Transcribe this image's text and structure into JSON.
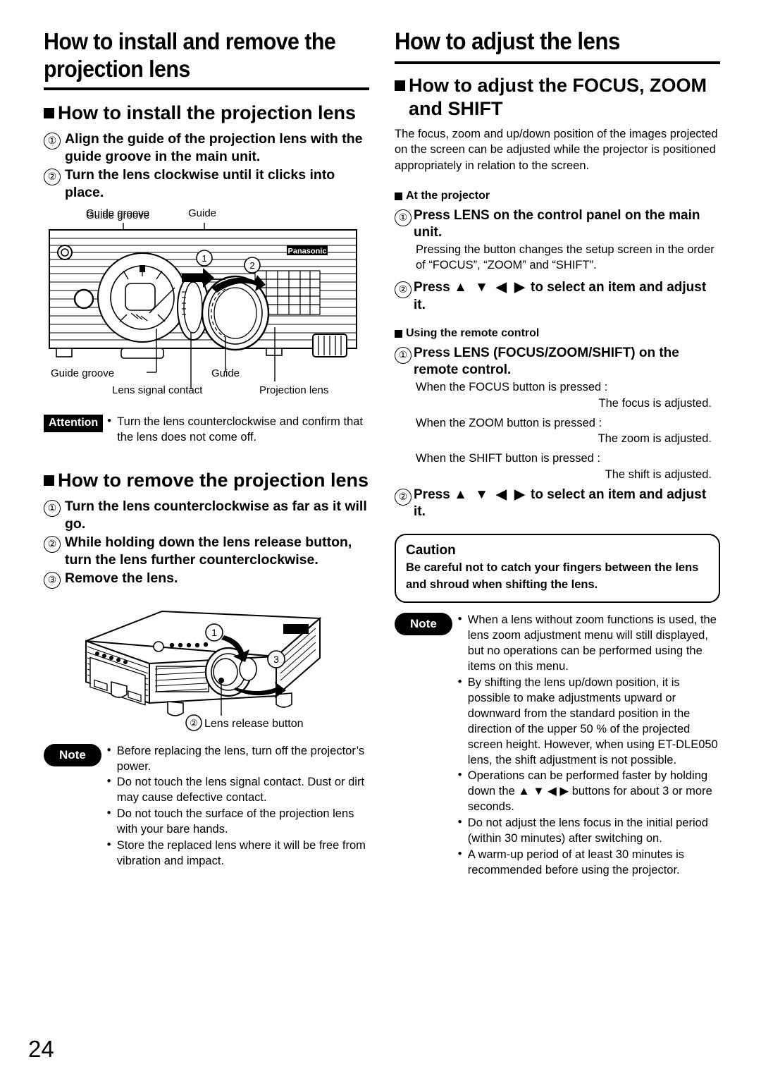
{
  "page": {
    "number": "24"
  },
  "left_column": {
    "title": "How to install and remove the projection lens",
    "install": {
      "heading": "How to install the projection lens",
      "steps": [
        {
          "num": "①",
          "text": "Align the guide of the projection lens with the guide groove in the main unit."
        },
        {
          "num": "②",
          "text": "Turn the lens clockwise until it clicks into place."
        }
      ],
      "figure": {
        "name": "lens-mount-illustration",
        "labels": {
          "guide_groove_top": "Guide groove",
          "guide_top": "Guide",
          "brand": "Panasonic",
          "marker_1": "1",
          "marker_2": "2",
          "guide_groove_bottom": "Guide groove",
          "guide_bottom": "Guide",
          "lens_signal_contact": "Lens signal contact",
          "projection_lens": "Projection lens"
        }
      },
      "attention": {
        "badge": "Attention",
        "items": [
          "Turn the lens counterclockwise and confirm that the lens does not come off."
        ]
      }
    },
    "remove": {
      "heading": "How to remove the projection lens",
      "steps": [
        {
          "num": "①",
          "text": "Turn the lens counterclockwise as far as it will go."
        },
        {
          "num": "②",
          "text": "While holding down the lens release button, turn the lens further counterclockwise."
        },
        {
          "num": "③",
          "text": "Remove the lens."
        }
      ],
      "figure": {
        "name": "projector-body-illustration",
        "labels": {
          "marker_1": "1",
          "marker_3": "3",
          "lens_release_button": "Lens release button",
          "lens_release_marker": "②"
        }
      },
      "note": {
        "badge": "Note",
        "items": [
          "Before replacing the lens, turn off the projector’s power.",
          "Do not touch the lens signal contact. Dust or dirt may cause defective contact.",
          "Do not touch the surface of the projection lens with your bare hands.",
          "Store the replaced lens where it will be free from vibration and impact."
        ]
      }
    }
  },
  "right_column": {
    "title": "How to adjust the lens",
    "adjust": {
      "heading": "How to adjust the FOCUS, ZOOM and SHIFT",
      "intro": "The focus, zoom and up/down position of the images projected on the screen can be adjusted while the projector is positioned appropriately in relation to the screen.",
      "at_projector": {
        "heading": "At the projector",
        "step1": {
          "num": "①",
          "text": "Press LENS on the control panel on the main unit."
        },
        "step1_note": "Pressing the button changes the setup screen in the order of “FOCUS”, “ZOOM” and “SHIFT”.",
        "step2": {
          "num": "②",
          "text_before": "Press",
          "arrows": "▲ ▼ ◀ ▶",
          "text_after": "to select an item and adjust it."
        }
      },
      "remote": {
        "heading": "Using the remote control",
        "step1": {
          "num": "①",
          "text": "Press LENS (FOCUS/ZOOM/SHIFT) on the remote control."
        },
        "pressed": [
          {
            "condition": "When the FOCUS button is pressed :",
            "result": "The focus is adjusted."
          },
          {
            "condition": "When the ZOOM button is pressed :",
            "result": "The zoom is adjusted."
          },
          {
            "condition": "When the SHIFT button is pressed :",
            "result": "The shift is adjusted."
          }
        ],
        "step2": {
          "num": "②",
          "text_before": "Press",
          "arrows": "▲ ▼ ◀ ▶",
          "text_after": "to select an item and adjust it."
        }
      },
      "caution": {
        "title": "Caution",
        "text": "Be careful not to catch your fingers between the lens and shroud when shifting the lens."
      },
      "note": {
        "badge": "Note",
        "items": [
          "When a lens without zoom functions is used, the lens zoom adjustment menu will still displayed, but no operations can be performed using the items on this menu.",
          "By shifting the lens up/down position, it is possible to make adjustments upward or downward from the standard position in the direction of the upper 50 % of the projected screen height. However, when using ET-DLE050 lens, the shift adjustment is not possible.",
          "Operations can be performed faster by holding down the ▲ ▼ ◀ ▶ buttons for about 3 or more seconds.",
          "Do not adjust the lens focus in the initial period (within 30 minutes) after switching on.",
          "A warm-up period of at least 30 minutes is recommended before using the projector."
        ]
      }
    }
  }
}
